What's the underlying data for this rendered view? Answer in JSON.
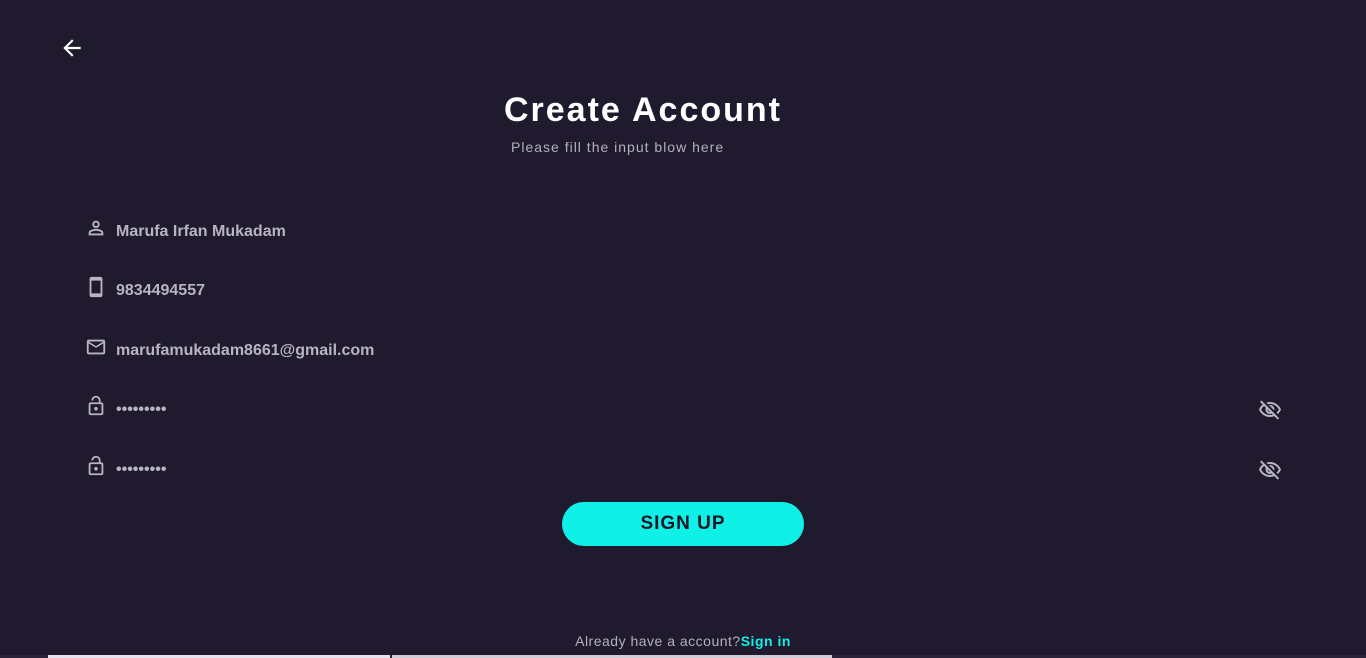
{
  "header": {
    "title": "Create Account",
    "subtitle": "Please fill the input blow here"
  },
  "icons": {
    "back": "arrow-left-icon",
    "name": "person-icon",
    "phone": "smartphone-icon",
    "email": "mail-icon",
    "password": "lock-icon",
    "visibility": "eye-off-icon"
  },
  "form": {
    "name_value": "Marufa Irfan Mukadam",
    "phone_value": "9834494557",
    "email_value": "marufamukadam8661@gmail.com",
    "password_value": "•••••••••",
    "confirm_password_value": "•••••••••"
  },
  "actions": {
    "signup_label": "SIGN UP"
  },
  "footer": {
    "question": "Already have a account?",
    "signin_label": "Sign in"
  },
  "colors": {
    "background": "#1f1a2e",
    "accent": "#0ff0e6",
    "text_primary": "#ffffff",
    "text_secondary": "#b8b4c2"
  }
}
